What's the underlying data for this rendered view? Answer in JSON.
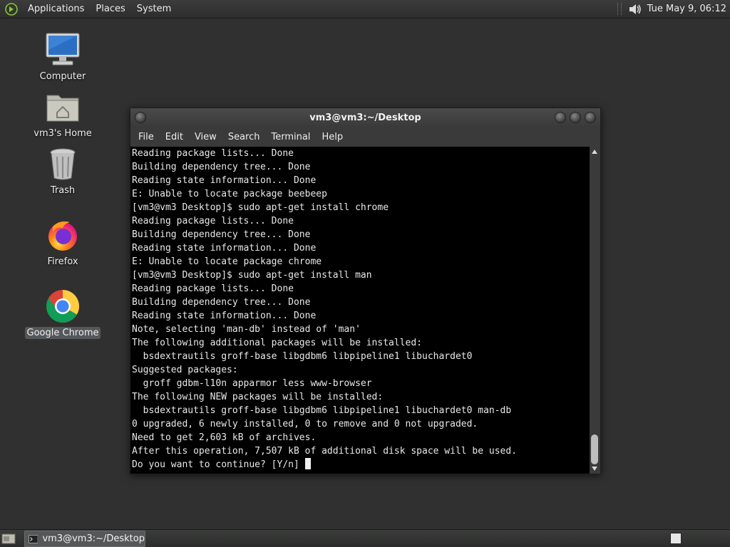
{
  "top_panel": {
    "menus": [
      "Applications",
      "Places",
      "System"
    ],
    "clock": "Tue May  9, 06:12"
  },
  "desktop_icons": [
    {
      "label": "Computer",
      "icon": "computer-icon"
    },
    {
      "label": "vm3's Home",
      "icon": "home-folder-icon"
    },
    {
      "label": "Trash",
      "icon": "trash-icon"
    },
    {
      "label": "Firefox",
      "icon": "firefox-icon"
    },
    {
      "label": "Google Chrome",
      "icon": "chrome-icon",
      "selected": true
    }
  ],
  "window": {
    "title": "vm3@vm3:~/Desktop",
    "menus": [
      "File",
      "Edit",
      "View",
      "Search",
      "Terminal",
      "Help"
    ],
    "lines": [
      "Reading package lists... Done",
      "Building dependency tree... Done",
      "Reading state information... Done",
      "E: Unable to locate package beebeep",
      "[vm3@vm3 Desktop]$ sudo apt-get install chrome",
      "Reading package lists... Done",
      "Building dependency tree... Done",
      "Reading state information... Done",
      "E: Unable to locate package chrome",
      "[vm3@vm3 Desktop]$ sudo apt-get install man",
      "Reading package lists... Done",
      "Building dependency tree... Done",
      "Reading state information... Done",
      "Note, selecting 'man-db' instead of 'man'",
      "The following additional packages will be installed:",
      "  bsdextrautils groff-base libgdbm6 libpipeline1 libuchardet0",
      "Suggested packages:",
      "  groff gdbm-l10n apparmor less www-browser",
      "The following NEW packages will be installed:",
      "  bsdextrautils groff-base libgdbm6 libpipeline1 libuchardet0 man-db",
      "0 upgraded, 6 newly installed, 0 to remove and 0 not upgraded.",
      "Need to get 2,603 kB of archives.",
      "After this operation, 7,507 kB of additional disk space will be used.",
      "Do you want to continue? [Y/n] "
    ]
  },
  "taskbar": {
    "task_label": "vm3@vm3:~/Desktop"
  }
}
